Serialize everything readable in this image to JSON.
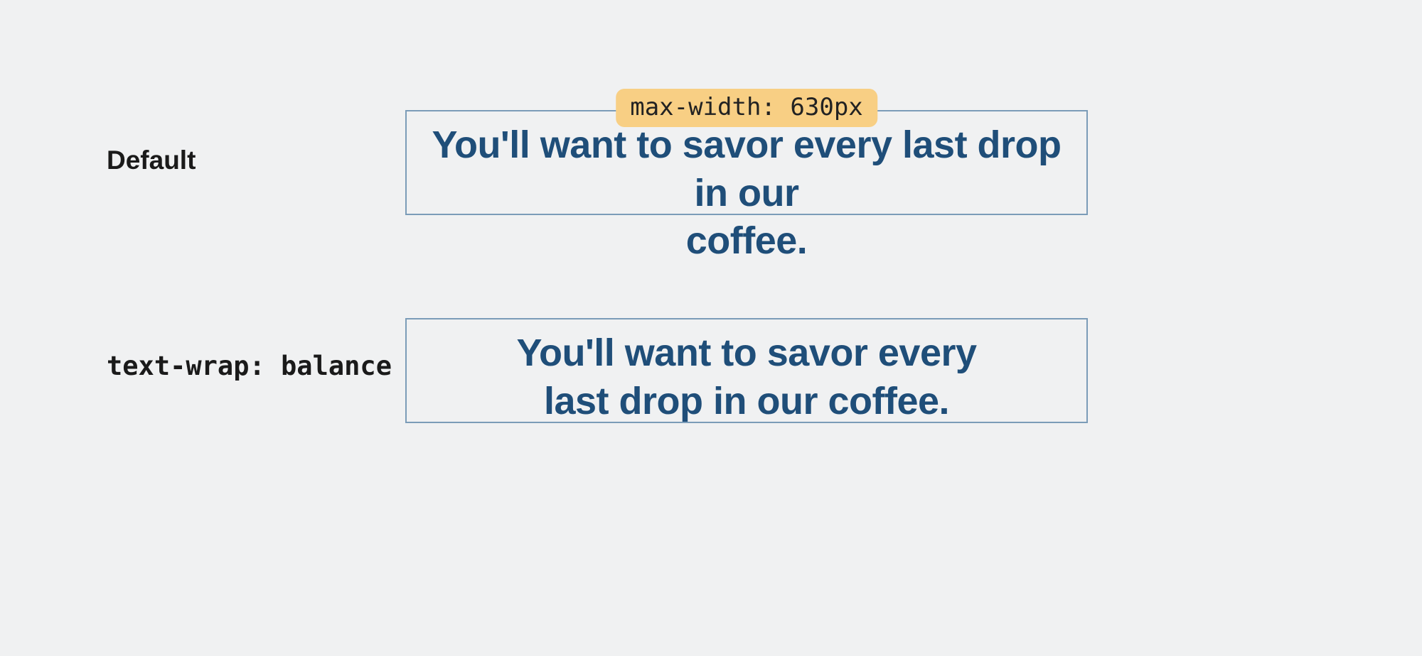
{
  "examples": [
    {
      "label": "Default",
      "label_mono": false,
      "badge": "max-width: 630px",
      "headline_line1": "You'll want to savor every last drop in our",
      "headline_line2": "coffee."
    },
    {
      "label": "text-wrap: balance",
      "label_mono": true,
      "badge": null,
      "headline_line1": "You'll want to savor every",
      "headline_line2": "last drop in our coffee."
    }
  ]
}
